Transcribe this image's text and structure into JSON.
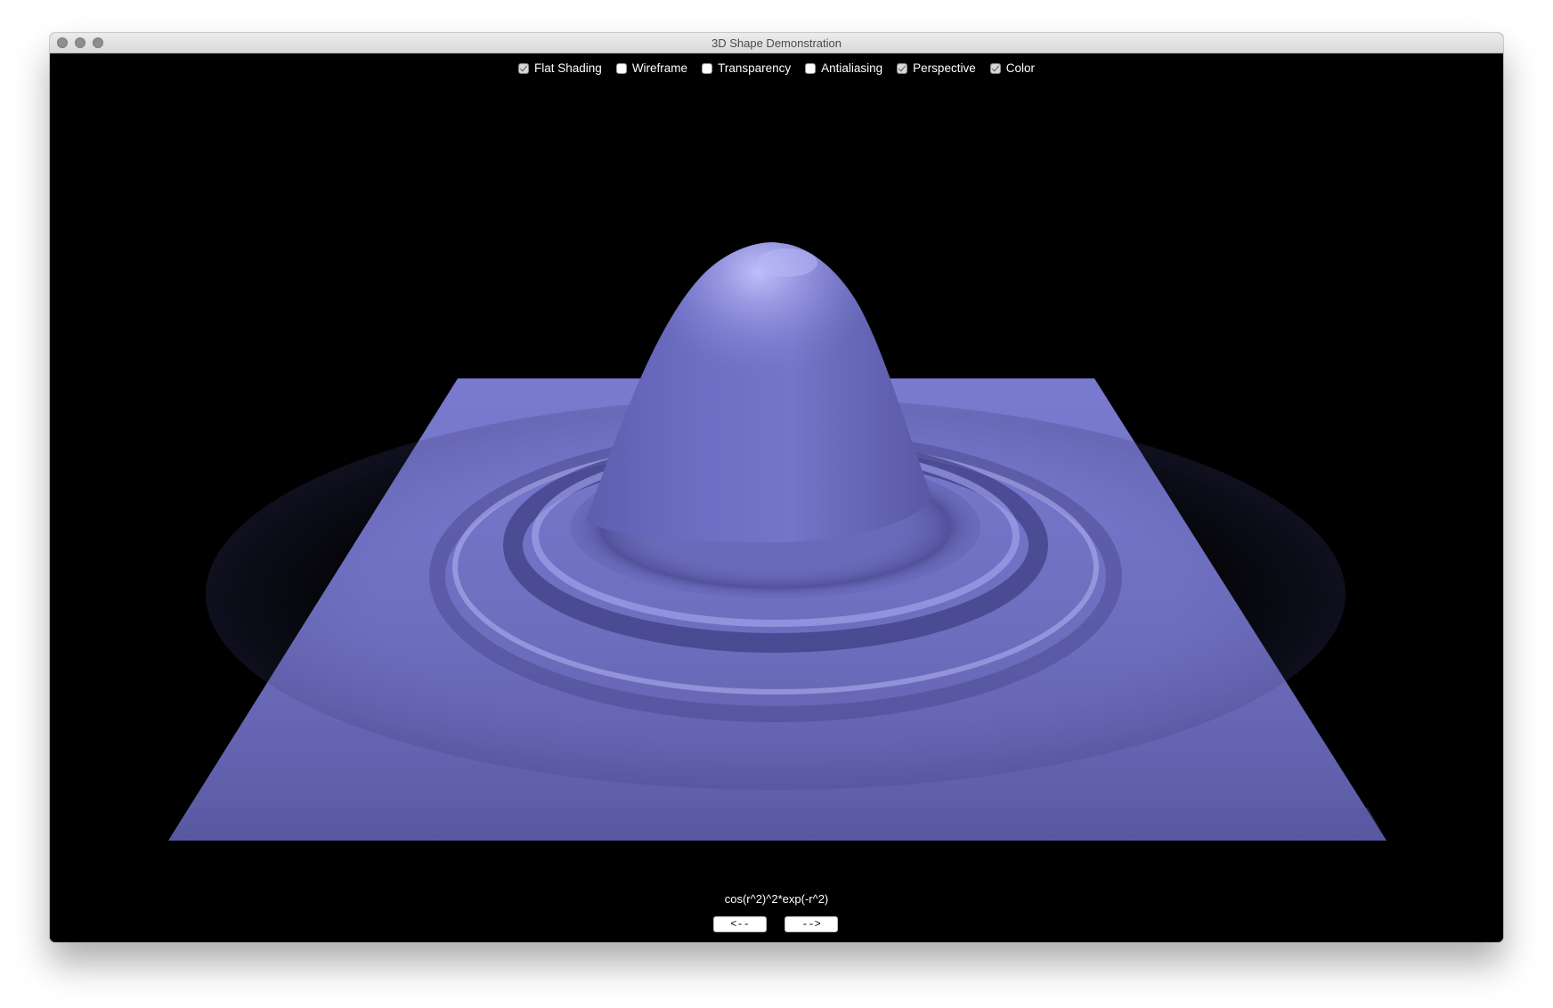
{
  "window": {
    "title": "3D Shape Demonstration"
  },
  "options": [
    {
      "label": "Flat Shading",
      "checked": true
    },
    {
      "label": "Wireframe",
      "checked": false
    },
    {
      "label": "Transparency",
      "checked": false
    },
    {
      "label": "Antialiasing",
      "checked": false
    },
    {
      "label": "Perspective",
      "checked": true
    },
    {
      "label": "Color",
      "checked": true
    }
  ],
  "viewer": {
    "formula": "cos(r^2)^2*exp(-r^2)",
    "prev_label": "<--",
    "next_label": "-->",
    "surface_color": "#6f6fc0",
    "background_color": "#000000"
  }
}
